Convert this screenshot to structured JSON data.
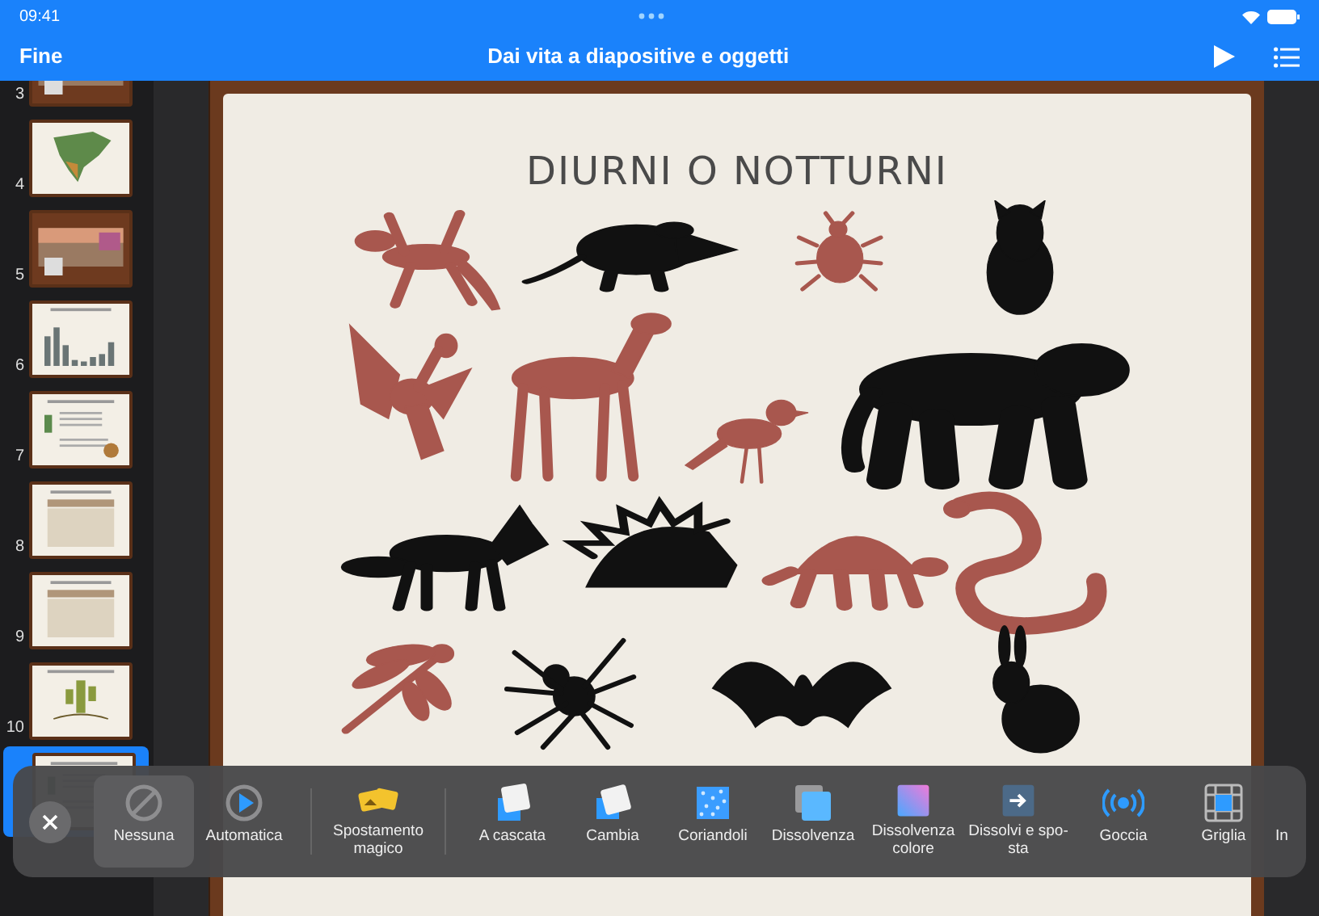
{
  "status_bar": {
    "time": "09:41"
  },
  "nav": {
    "done": "Fine",
    "title": "Dai vita a diapositive e oggetti"
  },
  "slides": [
    {
      "number": "3",
      "kind": "photos",
      "selected": false
    },
    {
      "number": "4",
      "kind": "map",
      "selected": false
    },
    {
      "number": "5",
      "kind": "photos",
      "selected": false
    },
    {
      "number": "6",
      "kind": "bars",
      "selected": false
    },
    {
      "number": "7",
      "kind": "text",
      "selected": false
    },
    {
      "number": "8",
      "kind": "table",
      "selected": false
    },
    {
      "number": "9",
      "kind": "table",
      "selected": false
    },
    {
      "number": "10",
      "kind": "cactus",
      "selected": false
    },
    {
      "kind": "text",
      "selected": true
    }
  ],
  "slide": {
    "title": "DIURNI O NOTTURNI",
    "rows": [
      [
        {
          "kind": "lizard",
          "color": "#a8574e"
        },
        {
          "kind": "rodent",
          "color": "#111111"
        },
        {
          "kind": "beetle",
          "color": "#a8574e"
        },
        {
          "kind": "owl",
          "color": "#111111"
        }
      ],
      [
        {
          "kind": "eagle",
          "color": "#a8574e"
        },
        {
          "kind": "deer",
          "color": "#a8574e"
        },
        {
          "kind": "bird",
          "color": "#a8574e"
        },
        {
          "kind": "cat",
          "color": "#111111"
        }
      ],
      [
        {
          "kind": "fox",
          "color": "#111111"
        },
        {
          "kind": "porcupine",
          "color": "#111111"
        },
        {
          "kind": "turtle",
          "color": "#a8574e"
        },
        {
          "kind": "snake",
          "color": "#a8574e"
        }
      ],
      [
        {
          "kind": "dragonfly",
          "color": "#a8574e"
        },
        {
          "kind": "spider",
          "color": "#111111"
        },
        {
          "kind": "bat",
          "color": "#111111"
        },
        {
          "kind": "rabbit",
          "color": "#111111"
        }
      ]
    ]
  },
  "transition_groups": [
    [
      {
        "label": "Nessuna",
        "kind": "none",
        "selected": true
      },
      {
        "label": "Automatica",
        "kind": "auto",
        "selected": false
      }
    ],
    [
      {
        "label": "Spostamento magico",
        "kind": "magic",
        "selected": false
      }
    ],
    [
      {
        "label": "A cascata",
        "kind": "cascade",
        "selected": false
      },
      {
        "label": "Cambia",
        "kind": "swap",
        "selected": false
      },
      {
        "label": "Coriandoli",
        "kind": "confetti",
        "selected": false
      },
      {
        "label": "Dissolvenza",
        "kind": "dissolve",
        "selected": false
      },
      {
        "label": "Dissolvenza colore",
        "kind": "colordissolve",
        "selected": false
      },
      {
        "label": "Dissolvi e spo-sta",
        "kind": "move",
        "selected": false
      },
      {
        "label": "Goccia",
        "kind": "drop",
        "selected": false
      },
      {
        "label": "Griglia",
        "kind": "grid",
        "selected": false
      },
      {
        "label": "In",
        "kind": "partial",
        "selected": false
      }
    ]
  ]
}
